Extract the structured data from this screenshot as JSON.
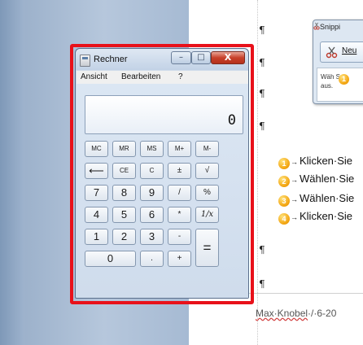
{
  "calculator": {
    "title": "Rechner",
    "controls": {
      "minimize": "–",
      "maximize": "□",
      "close": "X"
    },
    "menu": [
      "Ansicht",
      "Bearbeiten",
      "?"
    ],
    "display": "0",
    "keys": {
      "mc": "MC",
      "mr": "MR",
      "ms": "MS",
      "mplus": "M+",
      "mminus": "M-",
      "back": "⟵",
      "ce": "CE",
      "c": "C",
      "plusminus": "±",
      "sqrt": "√",
      "n7": "7",
      "n8": "8",
      "n9": "9",
      "div": "/",
      "pct": "%",
      "n4": "4",
      "n5": "5",
      "n6": "6",
      "mul": "*",
      "recip": "1/x",
      "n1": "1",
      "n2": "2",
      "n3": "3",
      "sub": "-",
      "eq": "=",
      "n0": "0",
      "dot": ".",
      "add": "+"
    },
    "highlight_color": "#e8111a"
  },
  "snipping_tool": {
    "title": "Snippi",
    "button_label": "Neu",
    "badge": "1",
    "text_line1_start": "Wä",
    "text_line1_end": "h S",
    "text_line2": "aus."
  },
  "document": {
    "pilcrow": "¶",
    "steps": [
      {
        "num": "1",
        "arrow": "→",
        "text": "Klicken·Sie"
      },
      {
        "num": "2",
        "arrow": "→",
        "text": "Wählen·Sie"
      },
      {
        "num": "3",
        "arrow": "→",
        "text": "Wählen·Sie"
      },
      {
        "num": "4",
        "arrow": "→",
        "text": "Klicken·Sie"
      }
    ],
    "footer_underlined": "Max·Knobel",
    "footer_rest": "·/·6-20"
  }
}
